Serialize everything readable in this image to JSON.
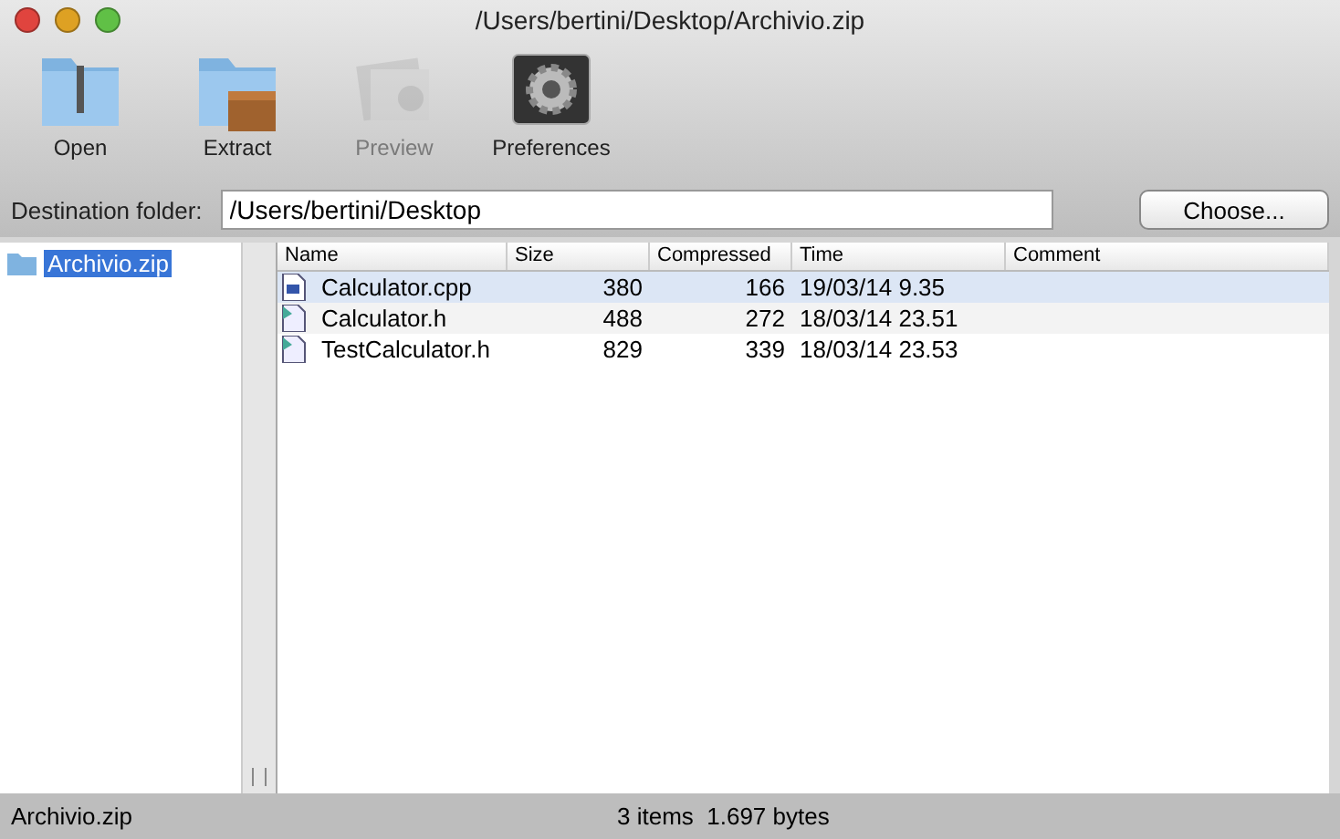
{
  "window": {
    "title": "/Users/bertini/Desktop/Archivio.zip"
  },
  "toolbar": [
    {
      "kind": "open",
      "label": "Open",
      "disabled": false
    },
    {
      "kind": "extract",
      "label": "Extract",
      "disabled": false
    },
    {
      "kind": "preview",
      "label": "Preview",
      "disabled": true
    },
    {
      "kind": "preferences",
      "label": "Preferences",
      "disabled": false
    }
  ],
  "destination": {
    "label": "Destination folder:",
    "value": "/Users/bertini/Desktop",
    "button": "Choose..."
  },
  "sidebar": {
    "items": [
      {
        "label": "Archivio.zip",
        "selected": true
      }
    ]
  },
  "table": {
    "columns": [
      "Name",
      "Size",
      "Compressed",
      "Time",
      "Comment"
    ],
    "rows": [
      {
        "kind": "cpp",
        "cells": [
          "Calculator.cpp",
          "380",
          "166",
          "19/03/14 9.35"
        ],
        "selected": true
      },
      {
        "kind": "h",
        "cells": [
          "Calculator.h",
          "488",
          "272",
          "18/03/14 23.51"
        ],
        "selected": false
      },
      {
        "kind": "h",
        "cells": [
          "TestCalculator.h",
          "829",
          "339",
          "18/03/14 23.53"
        ],
        "selected": false
      }
    ]
  },
  "status_bar": {
    "left": "Archivio.zip",
    "center": "3 items  1.697 bytes"
  }
}
